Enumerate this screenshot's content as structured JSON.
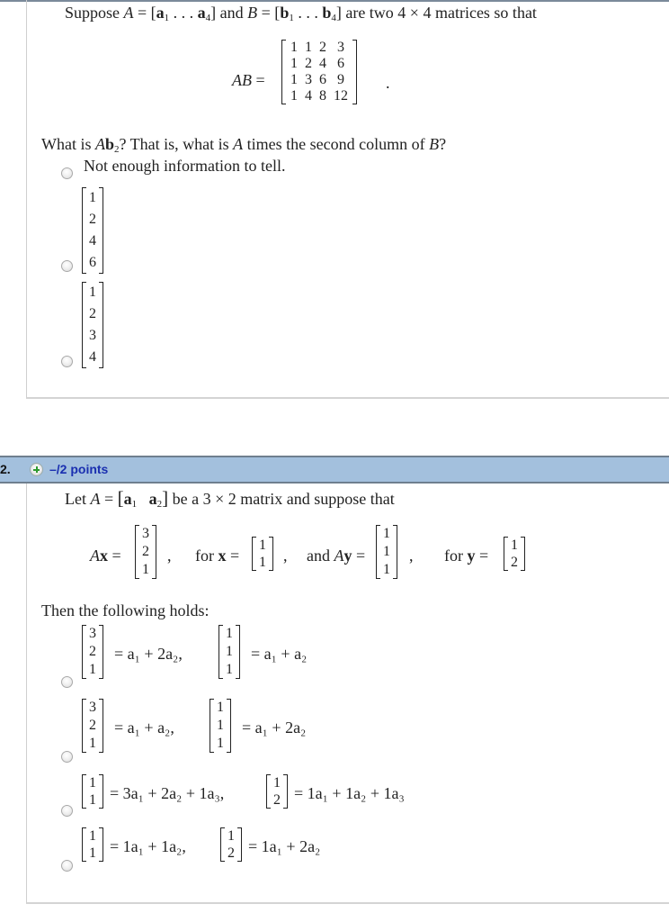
{
  "question1": {
    "intro": {
      "prefix": "Suppose ",
      "A": "A",
      "eq1": " = [",
      "a1": "a",
      "a1_sub": "1",
      "dots1": " . . . ",
      "a4": "a",
      "a4_sub": "4",
      "mid": "] and ",
      "B": "B",
      "eq2": " = [",
      "b1": "b",
      "b1_sub": "1",
      "dots2": " . . . ",
      "b4": "b",
      "b4_sub": "4",
      "suffix": "] are two 4 × 4 matrices so that"
    },
    "product_label": "AB",
    "equals": "=",
    "period": ".",
    "product_matrix": [
      [
        1,
        1,
        2,
        3
      ],
      [
        1,
        2,
        4,
        6
      ],
      [
        1,
        3,
        6,
        9
      ],
      [
        1,
        4,
        8,
        12
      ]
    ],
    "question": {
      "prefix": "What is ",
      "A": "A",
      "b": "b",
      "b_sub": "2",
      "mid": "? That is, what is ",
      "A2": "A",
      "mid2": " times the second column of ",
      "B": "B",
      "suffix": "?"
    },
    "options": [
      {
        "label": "Not enough information to tell."
      },
      {
        "vector": [
          1,
          2,
          4,
          6
        ]
      },
      {
        "vector": [
          1,
          2,
          3,
          4
        ]
      }
    ]
  },
  "question2_header": {
    "number": "2.",
    "points": "–/2 points",
    "icon": "plus-icon"
  },
  "question2": {
    "intro": {
      "prefix": "Let ",
      "A": "A",
      "eq": " = ",
      "a1": "a",
      "a1_sub": "1",
      "a2": "a",
      "a2_sub": "2",
      "suffix": " be a 3 × 2 matrix and suppose that"
    },
    "given": {
      "Ax_label": "A",
      "x_bold": "x",
      "Ax_vec": [
        3,
        2,
        1
      ],
      "for_x": "for ",
      "x_vec": [
        1,
        1
      ],
      "and": "and ",
      "Ay_label": "A",
      "y_bold": "y",
      "Ay_vec": [
        1,
        1,
        1
      ],
      "for_y": "for ",
      "y_vec": [
        1,
        2
      ]
    },
    "then": "Then the following holds:",
    "options": [
      {
        "lhs1": [
          3,
          2,
          1
        ],
        "rhs1": "= a₁ + 2a₂,",
        "lhs2": [
          1,
          1,
          1
        ],
        "rhs2": "= a₁ + a₂"
      },
      {
        "lhs1": [
          3,
          2,
          1
        ],
        "rhs1": "= a₁ + a₂,",
        "lhs2": [
          1,
          1,
          1
        ],
        "rhs2": "= a₁ + 2a₂"
      },
      {
        "lhs1": [
          1,
          1
        ],
        "rhs1": "= 3a₁ + 2a₂ + 1a₃,",
        "lhs2": [
          1,
          2
        ],
        "rhs2": "= 1a₁ + 1a₂ + 1a₃"
      },
      {
        "lhs1": [
          1,
          1
        ],
        "rhs1": "= 1a₁ + 1a₂,",
        "lhs2": [
          1,
          2
        ],
        "rhs2": "= 1a₁ + 2a₂"
      }
    ]
  }
}
